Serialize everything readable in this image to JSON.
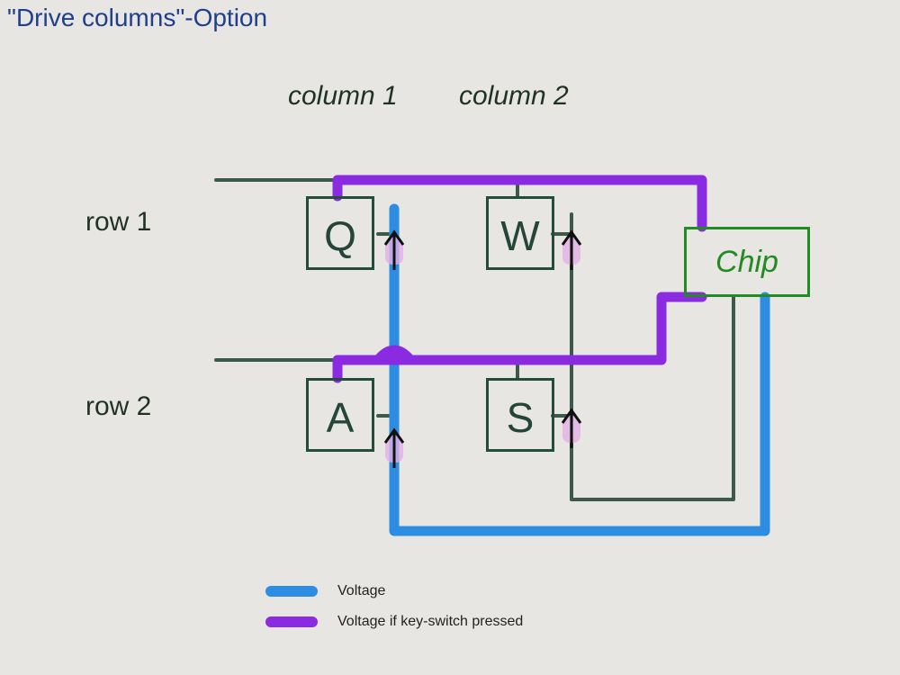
{
  "title": "\"Drive columns\"-Option",
  "columns": {
    "c1": "column 1",
    "c2": "column 2"
  },
  "rows": {
    "r1": "row 1",
    "r2": "row 2"
  },
  "keys": {
    "q": "Q",
    "w": "W",
    "a": "A",
    "s": "S"
  },
  "chip": "Chip",
  "legend": {
    "voltage": "Voltage",
    "voltage_if_pressed": "Voltage if key-switch pressed"
  },
  "colors": {
    "voltage": "#2c8de3",
    "voltage_if_pressed": "#8a2be2",
    "wire": "#3b5a4c",
    "key_border": "#234c3d",
    "chip_border": "#228b22",
    "title": "#1f3f8c"
  },
  "diagram": {
    "type": "keyboard-matrix",
    "option": "drive-columns",
    "grid": [
      [
        "Q",
        "W"
      ],
      [
        "A",
        "S"
      ]
    ],
    "row_lines": [
      "row 1",
      "row 2"
    ],
    "column_lines": [
      "column 1",
      "column 2"
    ],
    "controller": "Chip",
    "driven_lines": "columns",
    "sensed_lines": "rows",
    "diode_direction": "column-to-row"
  }
}
